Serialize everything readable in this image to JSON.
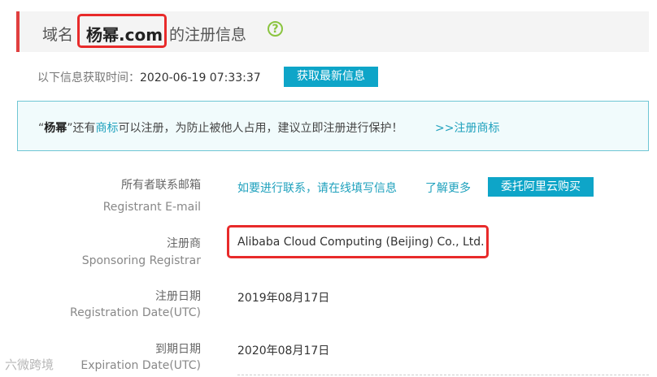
{
  "header": {
    "prefix": "域名",
    "domain": "杨幂.com",
    "suffix": "的注册信息",
    "help_icon": "question-circle-icon"
  },
  "fetch": {
    "label": "以下信息获取时间：",
    "time": "2020-06-19 07:33:37",
    "button": "获取最新信息"
  },
  "notice": {
    "quote_open": "“",
    "name": "杨幂",
    "mid1": "”还有",
    "trademark_link": "商标",
    "mid2": "可以注册，为防止被他人占用，建议立即注册进行保护！",
    "register_link": ">>注册商标"
  },
  "fields": {
    "email": {
      "label_cn": "所有者联系邮箱",
      "label_en": "Registrant E-mail",
      "contact_link": "如要进行联系，请在线填写信息",
      "learn_more": "了解更多",
      "buy_button": "委托阿里云购买"
    },
    "registrar": {
      "label_cn": "注册商",
      "label_en": "Sponsoring Registrar",
      "value": "Alibaba Cloud Computing (Beijing) Co., Ltd."
    },
    "reg_date": {
      "label_cn": "注册日期",
      "label_en": "Registration Date(UTC)",
      "value": "2019年08月17日"
    },
    "exp_date": {
      "label_cn": "到期日期",
      "label_en": "Expiration Date(UTC)",
      "value": "2020年08月17日"
    }
  },
  "watermark": "六微跨境",
  "colors": {
    "accent": "#0ea5c8",
    "highlight": "#e82a2a",
    "link": "#1fa1bd"
  }
}
